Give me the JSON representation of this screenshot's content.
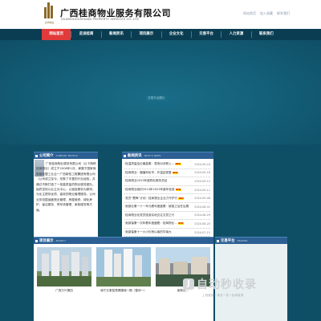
{
  "header": {
    "logo_caption": "兰商物业",
    "company_cn": "广西桂商物业服务有限公司",
    "company_en": "GUANGXIGUISHANG PROPERTY SERVICES CO.,LTD",
    "top_links": [
      "网站首页",
      "加入收藏",
      "联系我们"
    ]
  },
  "nav": {
    "items": [
      "网站首页",
      "走进桂商",
      "新闻资讯",
      "项目展示",
      "企业文化",
      "交易平台",
      "人力资源",
      "联系我们"
    ],
    "active_index": 0
  },
  "banner": {
    "label": "交易平台图片"
  },
  "intro": {
    "title": "公司简介",
    "subtitle": "COMPANY PROFILE",
    "more_label": "more",
    "text": "广西桂商物业服务有限公司（以下简称桂商物业）成立于2008年1月，隶属于国家商务部东盟工业企一广西新桂工程集团有限公司（公司成立至今，形象了丰富的行业经验，并通过不断打造了一批高质量的物业服务团队。始终坚持以业主为中心，以诚信服务为原则，为业主提供优质、高效的物业管理服务。公司业务范围涵盖物业管理、房屋维修、绿化养护、保洁服务、停车场管理、家政服务等方面。"
  },
  "news": {
    "title": "新闻资讯",
    "subtitle": "WHAT'S NEWS",
    "more_label": "more",
    "items": [
      {
        "title": "·桂温质量结论最高素：表场对对联入...",
        "date": "2024-09-24",
        "is_new": true
      },
      {
        "title": "·桂商物业：播播年轮市，外温结堂爱",
        "date": "2024-09-18",
        "is_new": true
      },
      {
        "title": "·桂商物业2023年度物业服务总结",
        "date": "2024-09-12",
        "is_new": false
      },
      {
        "title": "·桂商物业组织2014年2023年度年检查",
        "date": "2024-09-11",
        "is_new": true
      },
      {
        "title": "·党员“蓄锋”计划：桂商物业企业力守护行",
        "date": "2024-09-08",
        "is_new": true
      },
      {
        "title": "·吴镇业第一十一年元着年度盛着：被接之后在后展",
        "date": "2024-08-31",
        "is_new": false
      },
      {
        "title": "·桂商物业化党员旅游实地交往文党之行",
        "date": "2024-08-29",
        "is_new": false
      },
      {
        "title": "·吴镇保第一次年着年度盛着：桂商物业...",
        "date": "2024-08-20",
        "is_new": true
      },
      {
        "title": "·吴镇保第十一小小衍桥以南的华南大",
        "date": "2024-07-15",
        "is_new": false
      }
    ]
  },
  "projects": {
    "title": "项目展示",
    "subtitle": "PROJECT",
    "items": [
      {
        "caption": "广西万兴第四"
      },
      {
        "caption": "南宁五象智慧健康城一期（整体一）"
      },
      {
        "caption": "紫荆花…"
      }
    ]
  },
  "trade": {
    "title": "交易平台",
    "subtitle": "TRADING"
  },
  "watermark": {
    "badge": "J",
    "text": "自动秒收录",
    "sub": "上线链接一来访一次一自动收录"
  },
  "colors": {
    "page_bg": "#0f4f66",
    "nav_bg": "#0a3d52",
    "nav_active": "#e23a3a",
    "panel_head": "#2c5f93",
    "more_badge": "#f1c318"
  }
}
